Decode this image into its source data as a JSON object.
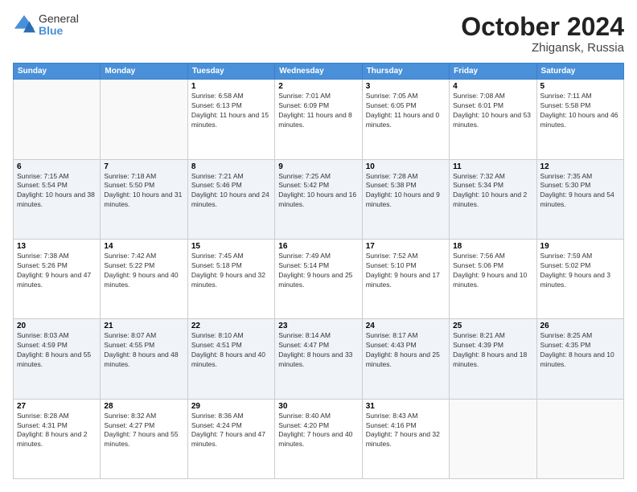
{
  "logo": {
    "general": "General",
    "blue": "Blue"
  },
  "header": {
    "month": "October 2024",
    "location": "Zhigansk, Russia"
  },
  "weekdays": [
    "Sunday",
    "Monday",
    "Tuesday",
    "Wednesday",
    "Thursday",
    "Friday",
    "Saturday"
  ],
  "weeks": [
    [
      {
        "day": "",
        "sunrise": "",
        "sunset": "",
        "daylight": ""
      },
      {
        "day": "",
        "sunrise": "",
        "sunset": "",
        "daylight": ""
      },
      {
        "day": "1",
        "sunrise": "Sunrise: 6:58 AM",
        "sunset": "Sunset: 6:13 PM",
        "daylight": "Daylight: 11 hours and 15 minutes."
      },
      {
        "day": "2",
        "sunrise": "Sunrise: 7:01 AM",
        "sunset": "Sunset: 6:09 PM",
        "daylight": "Daylight: 11 hours and 8 minutes."
      },
      {
        "day": "3",
        "sunrise": "Sunrise: 7:05 AM",
        "sunset": "Sunset: 6:05 PM",
        "daylight": "Daylight: 11 hours and 0 minutes."
      },
      {
        "day": "4",
        "sunrise": "Sunrise: 7:08 AM",
        "sunset": "Sunset: 6:01 PM",
        "daylight": "Daylight: 10 hours and 53 minutes."
      },
      {
        "day": "5",
        "sunrise": "Sunrise: 7:11 AM",
        "sunset": "Sunset: 5:58 PM",
        "daylight": "Daylight: 10 hours and 46 minutes."
      }
    ],
    [
      {
        "day": "6",
        "sunrise": "Sunrise: 7:15 AM",
        "sunset": "Sunset: 5:54 PM",
        "daylight": "Daylight: 10 hours and 38 minutes."
      },
      {
        "day": "7",
        "sunrise": "Sunrise: 7:18 AM",
        "sunset": "Sunset: 5:50 PM",
        "daylight": "Daylight: 10 hours and 31 minutes."
      },
      {
        "day": "8",
        "sunrise": "Sunrise: 7:21 AM",
        "sunset": "Sunset: 5:46 PM",
        "daylight": "Daylight: 10 hours and 24 minutes."
      },
      {
        "day": "9",
        "sunrise": "Sunrise: 7:25 AM",
        "sunset": "Sunset: 5:42 PM",
        "daylight": "Daylight: 10 hours and 16 minutes."
      },
      {
        "day": "10",
        "sunrise": "Sunrise: 7:28 AM",
        "sunset": "Sunset: 5:38 PM",
        "daylight": "Daylight: 10 hours and 9 minutes."
      },
      {
        "day": "11",
        "sunrise": "Sunrise: 7:32 AM",
        "sunset": "Sunset: 5:34 PM",
        "daylight": "Daylight: 10 hours and 2 minutes."
      },
      {
        "day": "12",
        "sunrise": "Sunrise: 7:35 AM",
        "sunset": "Sunset: 5:30 PM",
        "daylight": "Daylight: 9 hours and 54 minutes."
      }
    ],
    [
      {
        "day": "13",
        "sunrise": "Sunrise: 7:38 AM",
        "sunset": "Sunset: 5:26 PM",
        "daylight": "Daylight: 9 hours and 47 minutes."
      },
      {
        "day": "14",
        "sunrise": "Sunrise: 7:42 AM",
        "sunset": "Sunset: 5:22 PM",
        "daylight": "Daylight: 9 hours and 40 minutes."
      },
      {
        "day": "15",
        "sunrise": "Sunrise: 7:45 AM",
        "sunset": "Sunset: 5:18 PM",
        "daylight": "Daylight: 9 hours and 32 minutes."
      },
      {
        "day": "16",
        "sunrise": "Sunrise: 7:49 AM",
        "sunset": "Sunset: 5:14 PM",
        "daylight": "Daylight: 9 hours and 25 minutes."
      },
      {
        "day": "17",
        "sunrise": "Sunrise: 7:52 AM",
        "sunset": "Sunset: 5:10 PM",
        "daylight": "Daylight: 9 hours and 17 minutes."
      },
      {
        "day": "18",
        "sunrise": "Sunrise: 7:56 AM",
        "sunset": "Sunset: 5:06 PM",
        "daylight": "Daylight: 9 hours and 10 minutes."
      },
      {
        "day": "19",
        "sunrise": "Sunrise: 7:59 AM",
        "sunset": "Sunset: 5:02 PM",
        "daylight": "Daylight: 9 hours and 3 minutes."
      }
    ],
    [
      {
        "day": "20",
        "sunrise": "Sunrise: 8:03 AM",
        "sunset": "Sunset: 4:59 PM",
        "daylight": "Daylight: 8 hours and 55 minutes."
      },
      {
        "day": "21",
        "sunrise": "Sunrise: 8:07 AM",
        "sunset": "Sunset: 4:55 PM",
        "daylight": "Daylight: 8 hours and 48 minutes."
      },
      {
        "day": "22",
        "sunrise": "Sunrise: 8:10 AM",
        "sunset": "Sunset: 4:51 PM",
        "daylight": "Daylight: 8 hours and 40 minutes."
      },
      {
        "day": "23",
        "sunrise": "Sunrise: 8:14 AM",
        "sunset": "Sunset: 4:47 PM",
        "daylight": "Daylight: 8 hours and 33 minutes."
      },
      {
        "day": "24",
        "sunrise": "Sunrise: 8:17 AM",
        "sunset": "Sunset: 4:43 PM",
        "daylight": "Daylight: 8 hours and 25 minutes."
      },
      {
        "day": "25",
        "sunrise": "Sunrise: 8:21 AM",
        "sunset": "Sunset: 4:39 PM",
        "daylight": "Daylight: 8 hours and 18 minutes."
      },
      {
        "day": "26",
        "sunrise": "Sunrise: 8:25 AM",
        "sunset": "Sunset: 4:35 PM",
        "daylight": "Daylight: 8 hours and 10 minutes."
      }
    ],
    [
      {
        "day": "27",
        "sunrise": "Sunrise: 8:28 AM",
        "sunset": "Sunset: 4:31 PM",
        "daylight": "Daylight: 8 hours and 2 minutes."
      },
      {
        "day": "28",
        "sunrise": "Sunrise: 8:32 AM",
        "sunset": "Sunset: 4:27 PM",
        "daylight": "Daylight: 7 hours and 55 minutes."
      },
      {
        "day": "29",
        "sunrise": "Sunrise: 8:36 AM",
        "sunset": "Sunset: 4:24 PM",
        "daylight": "Daylight: 7 hours and 47 minutes."
      },
      {
        "day": "30",
        "sunrise": "Sunrise: 8:40 AM",
        "sunset": "Sunset: 4:20 PM",
        "daylight": "Daylight: 7 hours and 40 minutes."
      },
      {
        "day": "31",
        "sunrise": "Sunrise: 8:43 AM",
        "sunset": "Sunset: 4:16 PM",
        "daylight": "Daylight: 7 hours and 32 minutes."
      },
      {
        "day": "",
        "sunrise": "",
        "sunset": "",
        "daylight": ""
      },
      {
        "day": "",
        "sunrise": "",
        "sunset": "",
        "daylight": ""
      }
    ]
  ]
}
